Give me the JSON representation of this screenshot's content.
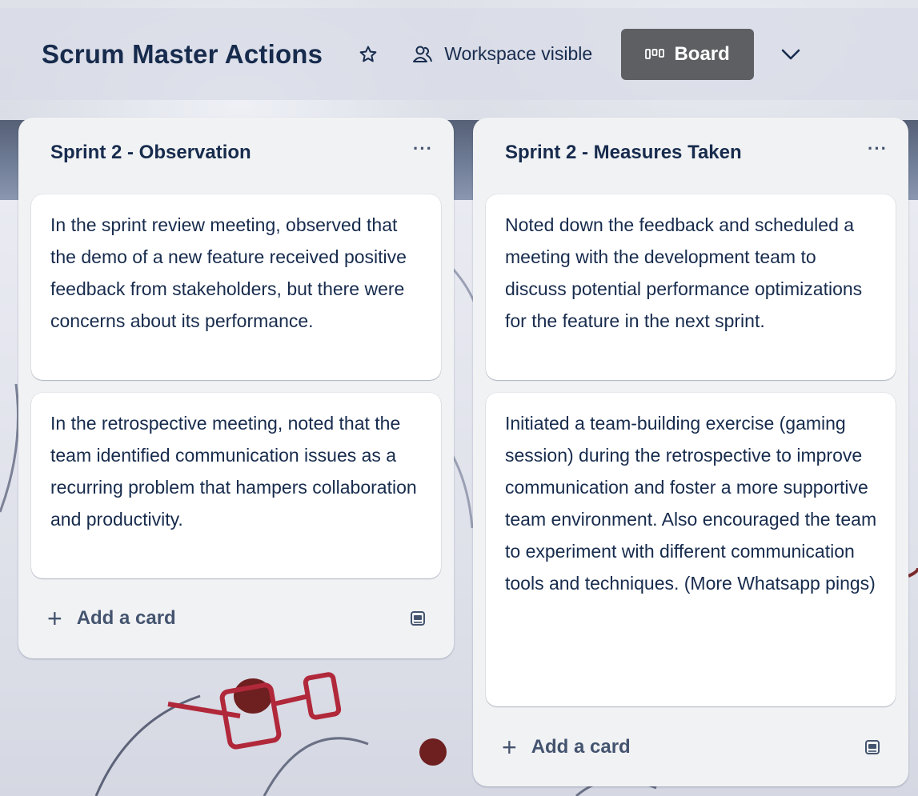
{
  "header": {
    "title": "Scrum Master Actions",
    "visibility_label": "Workspace visible",
    "view_label": "Board"
  },
  "lists": [
    {
      "title": "Sprint 2 - Observation",
      "more_label": "···",
      "cards": [
        "In the sprint review meeting, observed that the demo of a new feature received positive feedback from stakeholders, but there were concerns about its performance.",
        "In the retrospective meeting, noted that the team identified communication issues as a recurring problem that hampers collaboration and productivity."
      ],
      "add_card_label": "Add a card"
    },
    {
      "title": "Sprint 2 - Measures Taken",
      "more_label": "···",
      "cards": [
        "Noted down the feedback and scheduled a meeting with the development team to discuss potential performance optimizations for the feature in the next sprint.",
        "Initiated a team-building exercise (gaming session) during the retrospective to improve communication and foster a more supportive team environment. Also encouraged the team to experiment with different communication tools and techniques. (More Whatsapp pings)"
      ],
      "add_card_label": "Add a card"
    }
  ],
  "icons": {
    "star": "star-icon",
    "visibility": "people-icon",
    "view": "board-view-icon",
    "dropdown": "chevron-down-icon",
    "add": "plus-icon",
    "template": "card-template-icon"
  },
  "colors": {
    "text": "#172b4d",
    "list_bg": "#f1f2f4",
    "card_bg": "#ffffff",
    "board_button_bg": "#5e5f63"
  }
}
